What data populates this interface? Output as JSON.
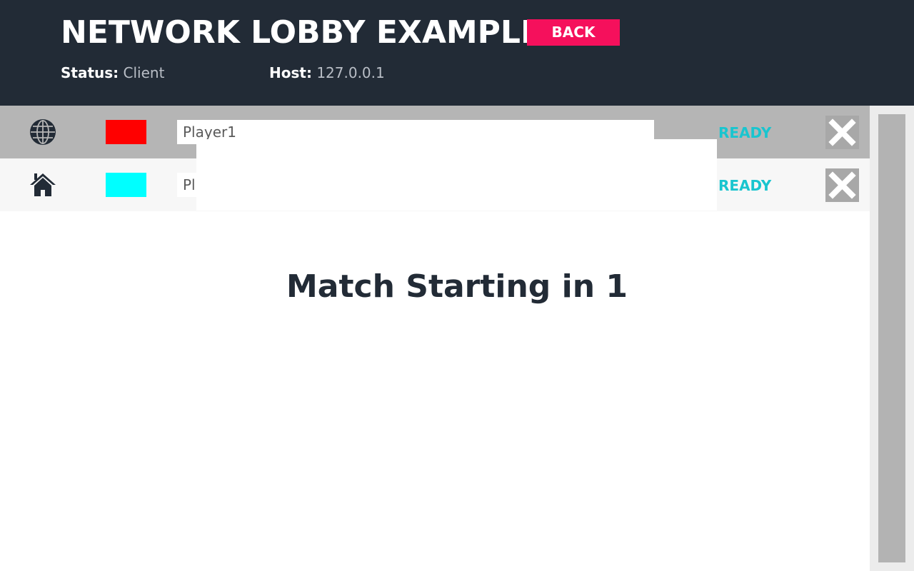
{
  "header": {
    "title": "NETWORK LOBBY EXAMPLE",
    "back_label": "BACK",
    "status_label": "Status:",
    "status_value": "Client",
    "host_label": "Host:",
    "host_value": "127.0.0.1"
  },
  "players": [
    {
      "icon": "globe-icon",
      "color": "#ff0000",
      "name": "Player1",
      "ready_label": "READY"
    },
    {
      "icon": "home-icon",
      "color": "#00ffff",
      "name": "Pl",
      "ready_label": "READY"
    }
  ],
  "countdown": {
    "text": "Match Starting in 1"
  },
  "colors": {
    "header_bg": "#222b36",
    "back_button": "#f5105c",
    "ready_text": "#19c5cf"
  }
}
